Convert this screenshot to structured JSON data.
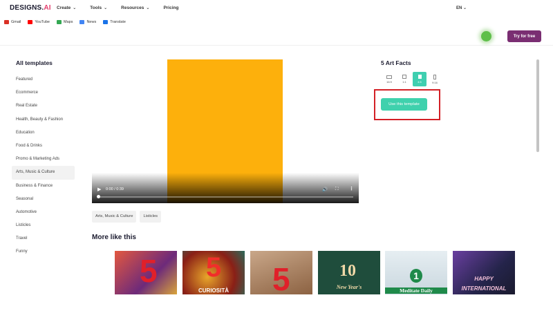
{
  "bookmarks": [
    {
      "label": "Gmail",
      "color": "#d93025"
    },
    {
      "label": "YouTube",
      "color": "#ff0000"
    },
    {
      "label": "Maps",
      "color": "#34a853"
    },
    {
      "label": "News",
      "color": "#4285f4"
    },
    {
      "label": "Translate",
      "color": "#1a73e8"
    }
  ],
  "header": {
    "logo_text": "DESIGNS.",
    "logo_suffix": "AI",
    "menu": [
      {
        "label": "Create"
      },
      {
        "label": "Tools"
      },
      {
        "label": "Resources"
      },
      {
        "label": "Pricing"
      }
    ],
    "language": "EN",
    "try_free": "Try for free"
  },
  "sidebar": {
    "title": "All templates",
    "items": [
      "Featured",
      "Ecommerce",
      "Real Estate",
      "Health, Beauty & Fashion",
      "Education",
      "Food & Drinks",
      "Promo & Marketing Ads",
      "Arts, Music & Culture",
      "Business & Finance",
      "Seasonal",
      "Automotive",
      "Listicles",
      "Travel",
      "Funny"
    ],
    "active_index": 7
  },
  "video": {
    "time": "0:00 / 0:39",
    "progress": 0.0,
    "frame_color": "#fdb00c"
  },
  "tags": [
    "Arts, Music & Culture",
    "Listicles"
  ],
  "more_title": "More like this",
  "thumbs": [
    {
      "big": "5",
      "caption": "",
      "bg": "#c44a3a"
    },
    {
      "big": "5",
      "caption": "CURIOSITÀ",
      "bg": "#8a1f16"
    },
    {
      "big": "5",
      "caption": "",
      "bg": "#b98f6c"
    },
    {
      "big": "10",
      "caption": "New Year's",
      "bg": "#1f4d3c"
    },
    {
      "big": "1",
      "caption": "Meditate Daily",
      "bg": "#d9e6ec"
    },
    {
      "big": "HAPPY",
      "caption": "INTERNATIONAL",
      "bg": "#24244a"
    }
  ],
  "right_panel": {
    "title": "5 Art Facts",
    "ratios": [
      "16:9",
      "1:1",
      "4:5",
      "9:16"
    ],
    "active_ratio": 2,
    "use_template": "Use this template",
    "accent": "#3fd1ad",
    "highlight_color": "#d31f25"
  }
}
